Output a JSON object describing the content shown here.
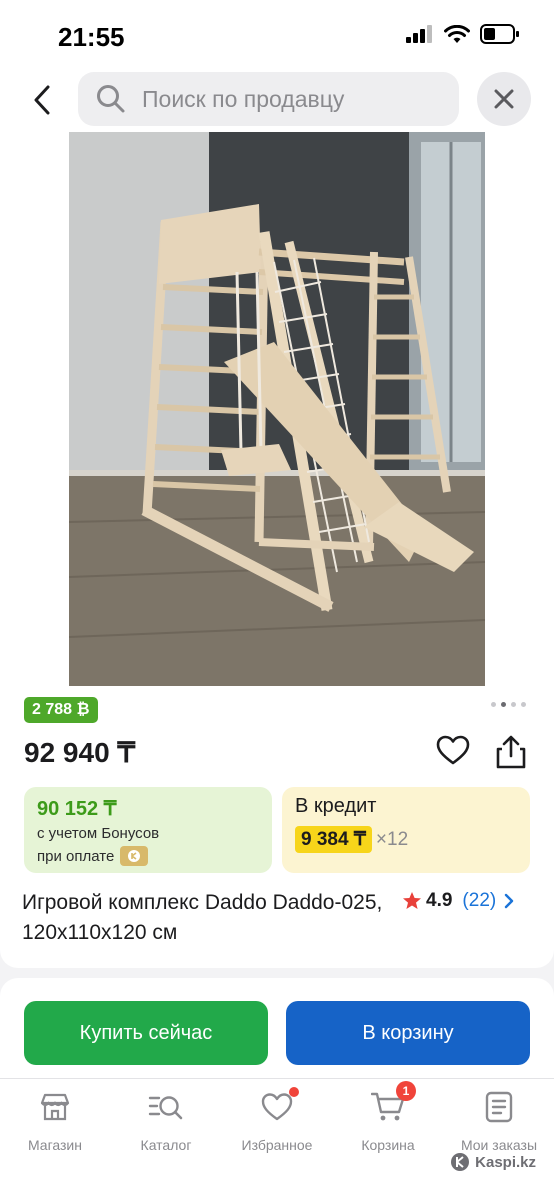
{
  "status": {
    "time": "21:55"
  },
  "search": {
    "placeholder": "Поиск по продавцу"
  },
  "product": {
    "bonus_badge": "2 788 ₿",
    "price": "92 940 ₸",
    "bonus_box": {
      "price": "90 152 ₸",
      "line1": "с учетом Бонусов",
      "line2": "при оплате"
    },
    "credit": {
      "title": "В кредит",
      "amount": "9 384 ₸",
      "multiplier": "×12"
    },
    "title": "Игровой комплекс Daddo Daddo-025, 120x110x120 см",
    "rating": "4.9",
    "reviews": "(22)",
    "gallery": {
      "count": 4,
      "active": 2
    }
  },
  "actions": {
    "buy_now": "Купить сейчас",
    "add_to_cart": "В корзину"
  },
  "tabbar": {
    "items": [
      {
        "label": "Магазин",
        "icon": "store-icon"
      },
      {
        "label": "Каталог",
        "icon": "catalog-search-icon"
      },
      {
        "label": "Избранное",
        "icon": "heart-icon"
      },
      {
        "label": "Корзина",
        "icon": "cart-icon",
        "badge": "1"
      },
      {
        "label": "Мои заказы",
        "icon": "orders-icon"
      }
    ]
  },
  "watermark": "Kaspi.kz",
  "colors": {
    "bonus_green": "#4ea82a",
    "buy_green": "#22a94a",
    "cart_blue": "#1663c7",
    "credit_yellow": "#f7d51a",
    "link_blue": "#1a73d8",
    "badge_red": "#f0443a"
  }
}
